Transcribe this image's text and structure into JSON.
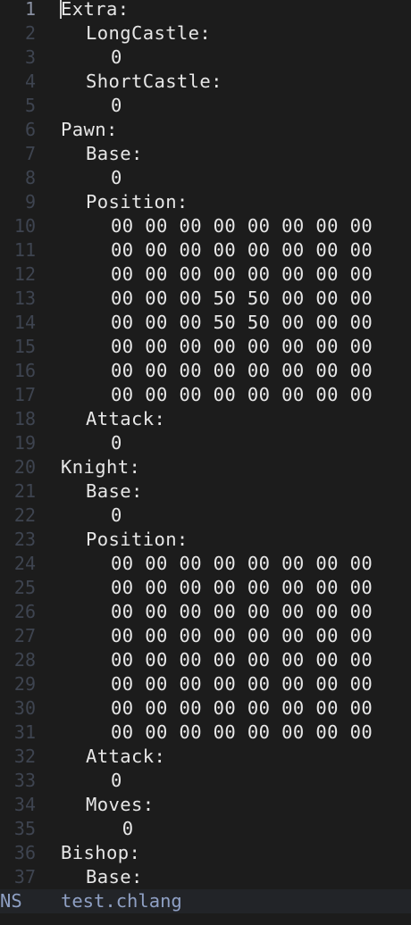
{
  "editor": {
    "current_line": 1,
    "lines": [
      {
        "n": "1",
        "indent": 0,
        "text": "Extra:"
      },
      {
        "n": "2",
        "indent": 1,
        "text": "LongCastle:"
      },
      {
        "n": "3",
        "indent": 2,
        "text": "0"
      },
      {
        "n": "4",
        "indent": 1,
        "text": "ShortCastle:"
      },
      {
        "n": "5",
        "indent": 2,
        "text": "0"
      },
      {
        "n": "6",
        "indent": 0,
        "text": "Pawn:"
      },
      {
        "n": "7",
        "indent": 1,
        "text": "Base:"
      },
      {
        "n": "8",
        "indent": 2,
        "text": "0"
      },
      {
        "n": "9",
        "indent": 1,
        "text": "Position:"
      },
      {
        "n": "10",
        "indent": 2,
        "text": "00 00 00 00 00 00 00 00"
      },
      {
        "n": "11",
        "indent": 2,
        "text": "00 00 00 00 00 00 00 00"
      },
      {
        "n": "12",
        "indent": 2,
        "text": "00 00 00 00 00 00 00 00"
      },
      {
        "n": "13",
        "indent": 2,
        "text": "00 00 00 50 50 00 00 00"
      },
      {
        "n": "14",
        "indent": 2,
        "text": "00 00 00 50 50 00 00 00"
      },
      {
        "n": "15",
        "indent": 2,
        "text": "00 00 00 00 00 00 00 00"
      },
      {
        "n": "16",
        "indent": 2,
        "text": "00 00 00 00 00 00 00 00"
      },
      {
        "n": "17",
        "indent": 2,
        "text": "00 00 00 00 00 00 00 00"
      },
      {
        "n": "18",
        "indent": 1,
        "text": "Attack:"
      },
      {
        "n": "19",
        "indent": 2,
        "text": "0"
      },
      {
        "n": "20",
        "indent": 0,
        "text": "Knight:"
      },
      {
        "n": "21",
        "indent": 1,
        "text": "Base:"
      },
      {
        "n": "22",
        "indent": 2,
        "text": "0"
      },
      {
        "n": "23",
        "indent": 1,
        "text": "Position:"
      },
      {
        "n": "24",
        "indent": 2,
        "text": "00 00 00 00 00 00 00 00"
      },
      {
        "n": "25",
        "indent": 2,
        "text": "00 00 00 00 00 00 00 00"
      },
      {
        "n": "26",
        "indent": 2,
        "text": "00 00 00 00 00 00 00 00"
      },
      {
        "n": "27",
        "indent": 2,
        "text": "00 00 00 00 00 00 00 00"
      },
      {
        "n": "28",
        "indent": 2,
        "text": "00 00 00 00 00 00 00 00"
      },
      {
        "n": "29",
        "indent": 2,
        "text": "00 00 00 00 00 00 00 00"
      },
      {
        "n": "30",
        "indent": 2,
        "text": "00 00 00 00 00 00 00 00"
      },
      {
        "n": "31",
        "indent": 2,
        "text": "00 00 00 00 00 00 00 00"
      },
      {
        "n": "32",
        "indent": 1,
        "text": "Attack:"
      },
      {
        "n": "33",
        "indent": 2,
        "text": "0"
      },
      {
        "n": "34",
        "indent": 1,
        "text": "Moves:"
      },
      {
        "n": "35",
        "indent": 2,
        "text": " 0"
      },
      {
        "n": "36",
        "indent": 0,
        "text": "Bishop:"
      },
      {
        "n": "37",
        "indent": 1,
        "text": "Base:"
      }
    ]
  },
  "statusline": {
    "mode": "NS",
    "filename": "test.chlang"
  }
}
